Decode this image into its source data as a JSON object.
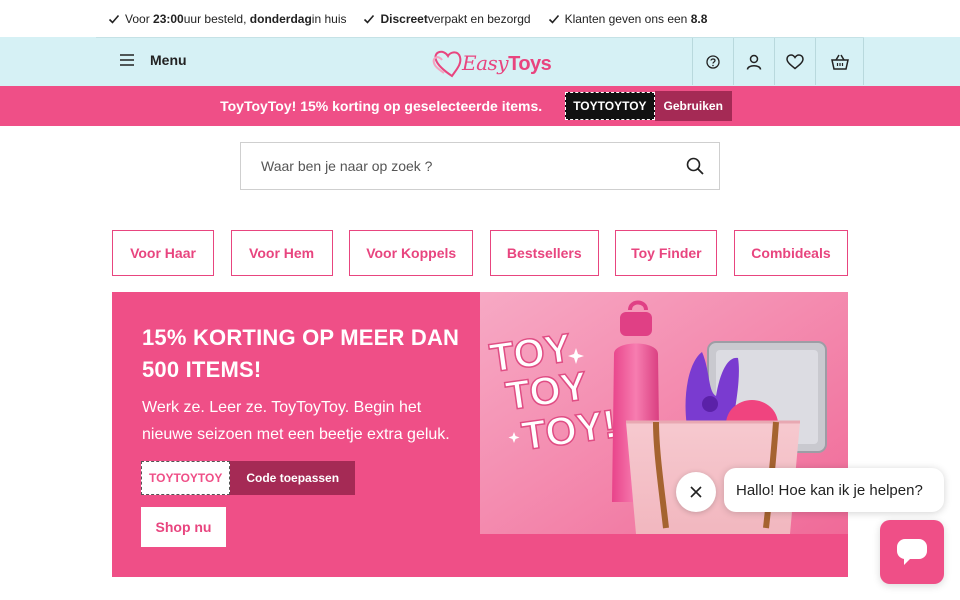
{
  "usp": {
    "item1": {
      "pre": "Voor ",
      "bold1": "23:00",
      "mid": " uur besteld, ",
      "bold2": "donderdag",
      "post": " in huis"
    },
    "item2": {
      "bold": "Discreet",
      "post": " verpakt en bezorgd"
    },
    "item3": {
      "pre": "Klanten geven ons een ",
      "bold": "8.8"
    }
  },
  "header": {
    "menu_label": "Menu",
    "logo_part1": "Easy",
    "logo_part2": "Toys",
    "icons": [
      "help-icon",
      "account-icon",
      "wishlist-heart-icon",
      "cart-basket-icon"
    ]
  },
  "promo": {
    "text": "ToyToyToy! 15% korting op geselecteerde items.",
    "code": "TOYTOYTOY",
    "apply_label": "Gebruiken"
  },
  "search": {
    "placeholder": "Waar ben je naar op zoek ?"
  },
  "categories": [
    "Voor Haar",
    "Voor Hem",
    "Voor Koppels",
    "Bestsellers",
    "Toy Finder",
    "Combideals"
  ],
  "hero": {
    "title": "15% KORTING OP MEER DAN 500 ITEMS!",
    "subtitle": "Werk ze. Leer ze. ToyToyToy. Begin het nieuwe seizoen met een beetje extra geluk.",
    "code": "TOYTOYTOY",
    "apply_label": "Code toepassen",
    "shop_label": "Shop nu",
    "image_words": [
      "TOY",
      "TOY",
      "TOY!"
    ]
  },
  "chat": {
    "message": "Hallo! Hoe kan ik je helpen?"
  },
  "colors": {
    "brand_pink": "#ef4f87",
    "dark_pink": "#a52a55",
    "header_bg": "#d6f1f5"
  }
}
